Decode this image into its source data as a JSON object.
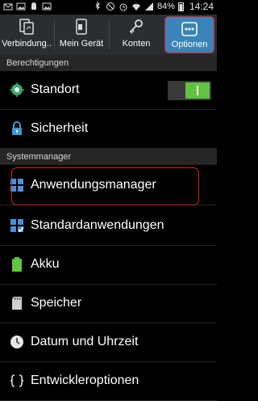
{
  "status_bar": {
    "battery": "84%",
    "time": "14:24"
  },
  "tabs": [
    {
      "label": "Verbindung..",
      "icon": "connections-icon"
    },
    {
      "label": "Mein Gerät",
      "icon": "device-icon"
    },
    {
      "label": "Konten",
      "icon": "key-icon"
    },
    {
      "label": "Optionen",
      "icon": "more-options-icon",
      "active": true
    }
  ],
  "sections": {
    "permissions": "Berechtigungen",
    "system_manager": "Systemmanager"
  },
  "items": {
    "standort": {
      "label": "Standort",
      "toggle_on": true
    },
    "sicherheit": {
      "label": "Sicherheit"
    },
    "anwendungsmanager": {
      "label": "Anwendungsmanager"
    },
    "standardanwendungen": {
      "label": "Standardanwendungen"
    },
    "akku": {
      "label": "Akku"
    },
    "speicher": {
      "label": "Speicher"
    },
    "datum": {
      "label": "Datum und Uhrzeit"
    },
    "entwickler": {
      "label": "Entwickleroptionen"
    }
  },
  "colors": {
    "accent": "#3b83b9",
    "highlight": "#d7202a",
    "toggle_on": "#62c341"
  }
}
